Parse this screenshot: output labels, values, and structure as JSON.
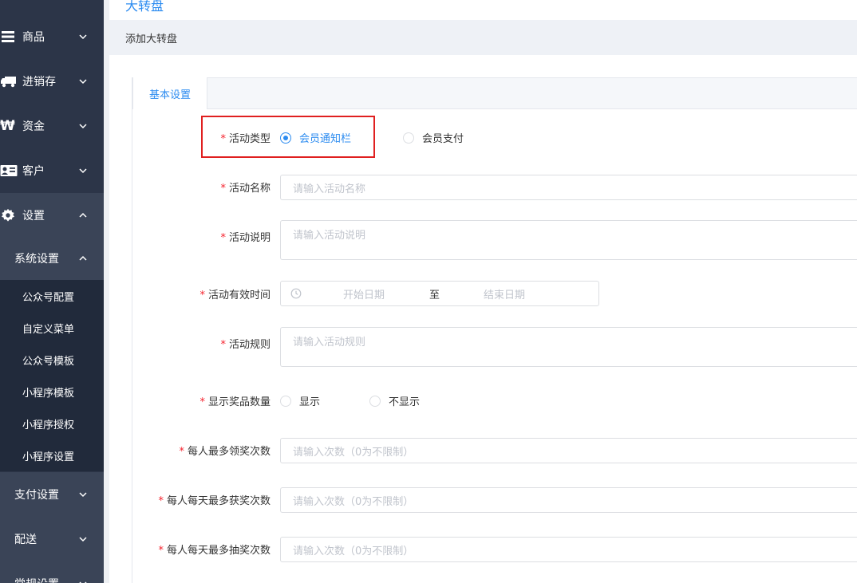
{
  "sidebar": {
    "items": [
      {
        "label": "商品",
        "icon": "menu-icon"
      },
      {
        "label": "进销存",
        "icon": "truck-icon"
      },
      {
        "label": "资金",
        "icon": "won-icon"
      },
      {
        "label": "客户",
        "icon": "id-card-icon"
      },
      {
        "label": "设置",
        "icon": "gear-icon"
      }
    ],
    "sub": {
      "label": "系统设置"
    },
    "subsub": [
      {
        "label": "公众号配置"
      },
      {
        "label": "自定义菜单"
      },
      {
        "label": "公众号模板"
      },
      {
        "label": "小程序模板"
      },
      {
        "label": "小程序授权"
      },
      {
        "label": "小程序设置"
      }
    ],
    "more": [
      {
        "label": "支付设置"
      },
      {
        "label": "配送"
      },
      {
        "label": "常规设置"
      }
    ]
  },
  "page": {
    "title": "大转盘",
    "breadcrumb": "添加大转盘",
    "tab": "基本设置"
  },
  "form": {
    "activity_type": {
      "label": "活动类型",
      "options": [
        "会员通知栏",
        "会员支付"
      ],
      "selected": "会员通知栏"
    },
    "activity_name": {
      "label": "活动名称",
      "placeholder": "请输入活动名称"
    },
    "activity_desc": {
      "label": "活动说明",
      "placeholder": "请输入活动说明"
    },
    "activity_time": {
      "label": "活动有效时间",
      "start": "开始日期",
      "sep": "至",
      "end": "结束日期"
    },
    "activity_rule": {
      "label": "活动规则",
      "placeholder": "请输入活动规则"
    },
    "show_prize_count": {
      "label": "显示奖品数量",
      "options": [
        "显示",
        "不显示"
      ]
    },
    "max_per_person": {
      "label": "每人最多领奖次数",
      "placeholder": "请输入次数（0为不限制）"
    },
    "max_win_per_day": {
      "label": "每人每天最多获奖次数",
      "placeholder": "请输入次数（0为不限制）"
    },
    "max_draw_per_day": {
      "label": "每人每天最多抽奖次数",
      "placeholder": "请输入次数（0为不限制）"
    }
  },
  "colors": {
    "accent": "#2d8cf0",
    "sidebar": "#2c3548",
    "highlight": "#e02020",
    "required": "#f5222d"
  }
}
